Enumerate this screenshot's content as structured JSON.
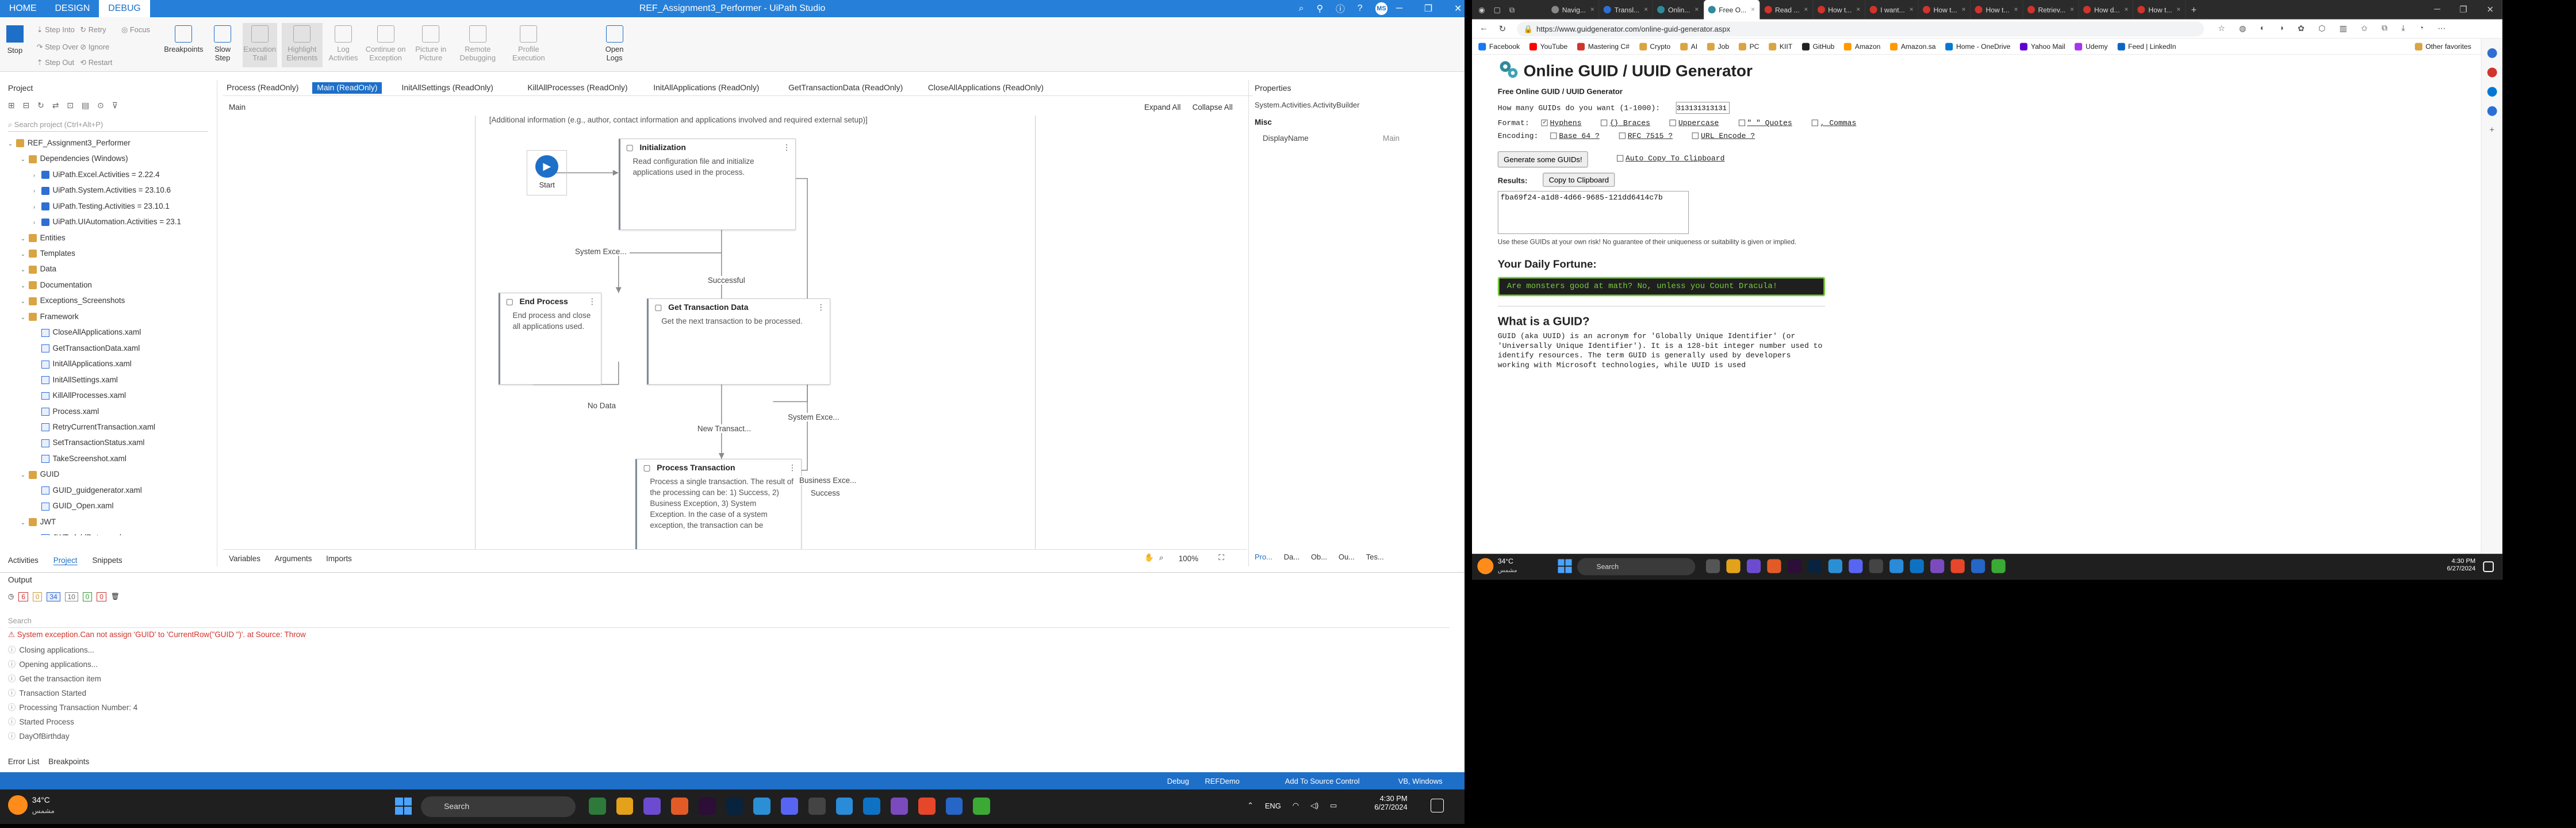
{
  "studio": {
    "title": "REF_Assignment3_Performer - UiPath Studio",
    "menu": [
      "HOME",
      "DESIGN",
      "DEBUG"
    ],
    "user_initials": "MS",
    "ribbon": {
      "stop": "Stop",
      "small1": [
        "Step Into",
        "Step Over",
        "Step Out"
      ],
      "small2": [
        "Retry",
        "Ignore",
        "Restart"
      ],
      "focus": "Focus",
      "big": [
        "Breakpoints",
        "Slow Step",
        "Execution Trail",
        "Highlight Elements",
        "Log Activities",
        "Continue on Exception",
        "Picture in Picture",
        "Remote Debugging",
        "Profile Execution",
        "Open Logs"
      ]
    },
    "project": {
      "header": "Project",
      "search_placeholder": "Search project (Ctrl+Alt+P)",
      "tree": [
        {
          "label": "REF_Assignment3_Performer",
          "level": 0,
          "kind": "root"
        },
        {
          "label": "Dependencies (Windows)",
          "level": 1,
          "kind": "folder"
        },
        {
          "label": "UiPath.Excel.Activities = 2.22.4",
          "level": 2,
          "kind": "pkg"
        },
        {
          "label": "UiPath.System.Activities = 23.10.6",
          "level": 2,
          "kind": "pkg"
        },
        {
          "label": "UiPath.Testing.Activities = 23.10.1",
          "level": 2,
          "kind": "pkg"
        },
        {
          "label": "UiPath.UIAutomation.Activities = 23.1",
          "level": 2,
          "kind": "pkg"
        },
        {
          "label": "Entities",
          "level": 1,
          "kind": "folder"
        },
        {
          "label": "Templates",
          "level": 1,
          "kind": "folder"
        },
        {
          "label": "Data",
          "level": 1,
          "kind": "folder"
        },
        {
          "label": "Documentation",
          "level": 1,
          "kind": "folder"
        },
        {
          "label": "Exceptions_Screenshots",
          "level": 1,
          "kind": "folder"
        },
        {
          "label": "Framework",
          "level": 1,
          "kind": "folder"
        },
        {
          "label": "CloseAllApplications.xaml",
          "level": 2,
          "kind": "file"
        },
        {
          "label": "GetTransactionData.xaml",
          "level": 2,
          "kind": "file"
        },
        {
          "label": "InitAllApplications.xaml",
          "level": 2,
          "kind": "file"
        },
        {
          "label": "InitAllSettings.xaml",
          "level": 2,
          "kind": "file"
        },
        {
          "label": "KillAllProcesses.xaml",
          "level": 2,
          "kind": "file"
        },
        {
          "label": "Process.xaml",
          "level": 2,
          "kind": "file"
        },
        {
          "label": "RetryCurrentTransaction.xaml",
          "level": 2,
          "kind": "file"
        },
        {
          "label": "SetTransactionStatus.xaml",
          "level": 2,
          "kind": "file"
        },
        {
          "label": "TakeScreenshot.xaml",
          "level": 2,
          "kind": "file"
        },
        {
          "label": "GUID",
          "level": 1,
          "kind": "folder"
        },
        {
          "label": "GUID_guidgenerator.xaml",
          "level": 2,
          "kind": "file"
        },
        {
          "label": "GUID_Open.xaml",
          "level": 2,
          "kind": "file"
        },
        {
          "label": "JWT",
          "level": 1,
          "kind": "folder"
        },
        {
          "label": "JWT_AddData.xaml",
          "level": 2,
          "kind": "file"
        }
      ],
      "bottom_tabs": [
        "Activities",
        "Project",
        "Snippets"
      ]
    },
    "doc_tabs": [
      "Process (ReadOnly)",
      "Main (ReadOnly)",
      "InitAllSettings (ReadOnly)",
      "KillAllProcesses (ReadOnly)",
      "InitAllApplications (ReadOnly)",
      "GetTransactionData (ReadOnly)",
      "CloseAllApplications (ReadOnly)"
    ],
    "designer": {
      "breadcrumb": "Main",
      "expand_all": "Expand All",
      "collapse_all": "Collapse All",
      "annotation": "[Additional information (e.g., author, contact information and applications involved and required external setup)]",
      "start": "Start",
      "cards": [
        {
          "title": "Initialization",
          "desc": "Read configuration file and initialize applications used in the process."
        },
        {
          "title": "End Process",
          "desc": "End process and close all applications used."
        },
        {
          "title": "Get Transaction Data",
          "desc": "Get the next transaction to be processed."
        },
        {
          "title": "Process Transaction",
          "desc": "Process a single transaction. The result of the processing can be: 1) Success, 2) Business Exception, 3) System Exception. In the case of a system exception, the transaction can be"
        }
      ],
      "edges": [
        "System Exce...",
        "Successful",
        "No Data",
        "New Transact...",
        "System Exce...",
        "Business Exce...",
        "Success"
      ],
      "bottom_tabs": [
        "Variables",
        "Arguments",
        "Imports"
      ],
      "zoom": "100%"
    },
    "properties": {
      "header": "Properties",
      "type": "System.Activities.ActivityBuilder",
      "category": "Misc",
      "field": "DisplayName",
      "value": "Main"
    },
    "right_tabs": [
      "Pro...",
      "Da...",
      "Ob...",
      "Ou...",
      "Tes..."
    ],
    "output": {
      "header": "Output",
      "counts": [
        "6",
        "0",
        "34",
        "10",
        "0",
        "0"
      ],
      "search_placeholder": "Search",
      "error": "System exception.Can not assign 'GUID' to 'CurrentRow(\"GUID \")'. at Source: Throw",
      "lines": [
        "Closing applications...",
        "Opening applications...",
        "Get the transaction item",
        "Transaction Started",
        "Processing Transaction Number: 4",
        "Started Process",
        "DayOfBirthday"
      ]
    },
    "bottom_bar": [
      "Error List",
      "Breakpoints"
    ],
    "status": {
      "debug": "Debug",
      "robot": "REFDemo",
      "source": "Add To Source Control",
      "platform": "VB, Windows"
    }
  },
  "taskbar": {
    "temp": "34°C",
    "temp_sub": "مشمس",
    "search": "Search",
    "time": "4:30 PM",
    "date": "6/27/2024",
    "lang": "ENG"
  },
  "browser": {
    "tabs": [
      "Navig...",
      "Transl...",
      "Onlin...",
      "Free O...",
      "Read ...",
      "How t...",
      "I want...",
      "How t...",
      "How t...",
      "Retriev...",
      "How d...",
      "How t..."
    ],
    "url": "https://www.guidgenerator.com/online-guid-generator.aspx",
    "bookmarks": [
      "Facebook",
      "YouTube",
      "Mastering C#",
      "Crypto",
      "AI",
      "Job",
      "PC",
      "KIIT",
      "GitHub",
      "Amazon",
      "Amazon.sa",
      "Home - OneDrive",
      "Yahoo Mail",
      "Udemy",
      "Feed | LinkedIn"
    ],
    "other_favorites": "Other favorites",
    "page": {
      "title": "Online GUID / UUID Generator",
      "subtitle": "Free Online GUID / UUID Generator",
      "how_many_label": "How many GUIDs do you want (1-1000):",
      "how_many_value": "313131313131",
      "format_label": "Format:",
      "opts1": [
        "Hyphens",
        "{} Braces",
        "Uppercase",
        "\" \" Quotes",
        ", Commas"
      ],
      "encoding_label": "Encoding:",
      "opts2": [
        "Base 64 ?",
        "RFC 7515 ?",
        "URL Encode ?"
      ],
      "generate_btn": "Generate some GUIDs!",
      "auto_copy": "Auto Copy To Clipboard",
      "results_label": "Results:",
      "copy_btn": "Copy to Clipboard",
      "result": "fba69f24-a1d8-4d66-9685-121dd6414c7b",
      "disclaimer": "Use these GUIDs at your own risk! No guarantee of their uniqueness or suitability is given or implied.",
      "fortune_title": "Your Daily Fortune:",
      "fortune": "Are monsters good at math? No, unless you Count Dracula!",
      "what_title": "What is a GUID?",
      "what_text": "GUID (aka UUID) is an acronym for 'Globally Unique Identifier' (or 'Universally Unique Identifier'). It is a 128-bit integer number used to identify resources. The term GUID is generally used by developers working with Microsoft technologies, while UUID is used"
    }
  }
}
